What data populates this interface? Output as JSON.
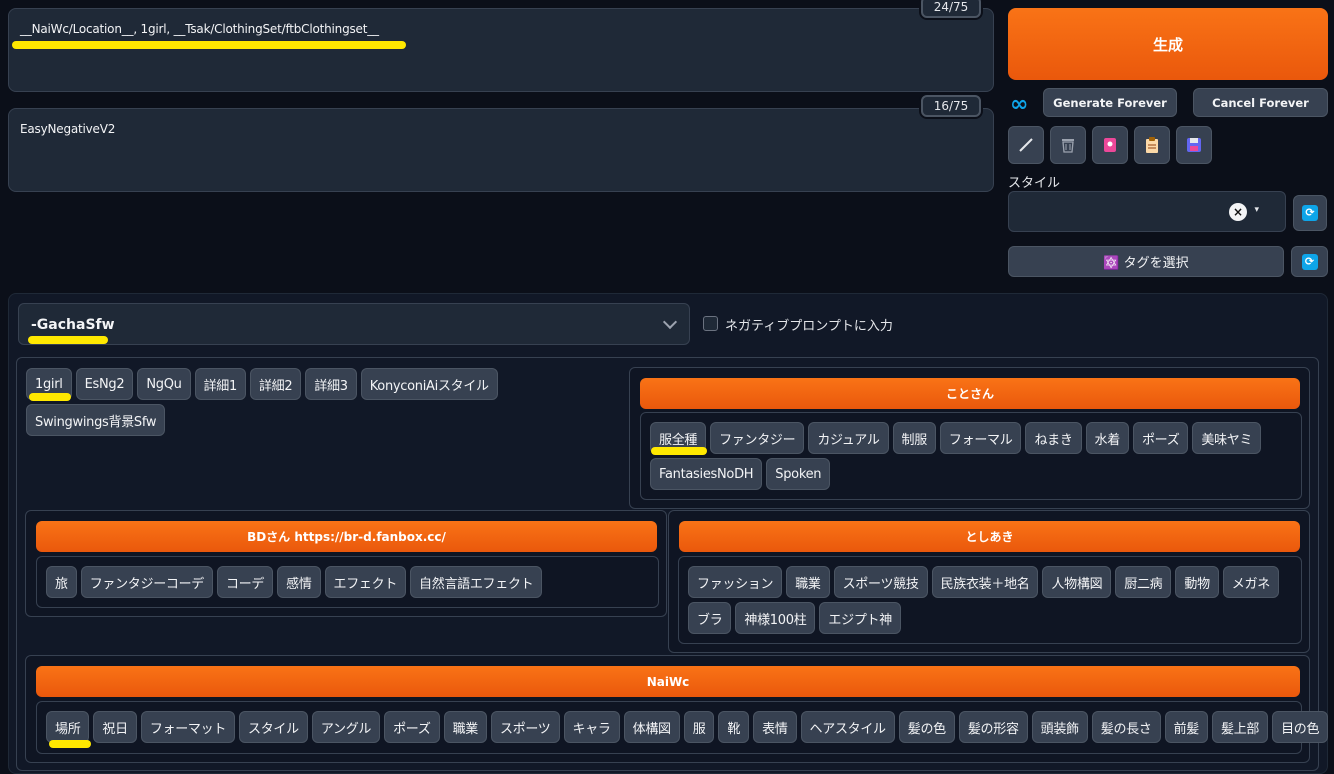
{
  "prompt": {
    "text": "__NaiWc/Location__, 1girl, __Tsak/ClothingSet/ftbClothingset__",
    "counter": "24/75"
  },
  "negative_prompt": {
    "text": "EasyNegativeV2",
    "counter": "16/75"
  },
  "actions": {
    "generate": "生成",
    "generate_forever": "Generate Forever",
    "cancel_forever": "Cancel Forever",
    "infinity": "∞"
  },
  "tools": [
    "pencil-icon",
    "trash-icon",
    "pink-card-icon",
    "clipboard-icon",
    "save-icon"
  ],
  "style": {
    "label": "スタイル",
    "clear": "×",
    "caret": "▾"
  },
  "tag_select": {
    "label": "🔯 タグを選択",
    "refresh": "⟳"
  },
  "wildcard": {
    "selected": "-GachaSfw",
    "negative_checkbox_label": "ネガティブプロンプトに入力"
  },
  "top_tags": [
    "1girl",
    "EsNg2",
    "NgQu",
    "詳細1",
    "詳細2",
    "詳細3",
    "KonyconiAiスタイル",
    "Swingwings背景Sfw"
  ],
  "groups": {
    "kotosan": {
      "title": "ことさん",
      "tags": [
        "服全種",
        "ファンタジー",
        "カジュアル",
        "制服",
        "フォーマル",
        "ねまき",
        "水着",
        "ポーズ",
        "美味ヤミ",
        "FantasiesNoDH",
        "Spoken"
      ]
    },
    "bd": {
      "title": "BDさん https://br-d.fanbox.cc/",
      "tags": [
        "旅",
        "ファンタジーコーデ",
        "コーデ",
        "感情",
        "エフェクト",
        "自然言語エフェクト"
      ]
    },
    "toshiaki": {
      "title": "としあき",
      "tags": [
        "ファッション",
        "職業",
        "スポーツ競技",
        "民族衣装＋地名",
        "人物構図",
        "厨二病",
        "動物",
        "メガネ",
        "ブラ",
        "神様100柱",
        "エジプト神"
      ]
    },
    "naiwc": {
      "title": "NaiWc",
      "tags": [
        "場所",
        "祝日",
        "フォーマット",
        "スタイル",
        "アングル",
        "ポーズ",
        "職業",
        "スポーツ",
        "キャラ",
        "体構図",
        "服",
        "靴",
        "表情",
        "ヘアスタイル",
        "髪の色",
        "髪の形容",
        "頭装飾",
        "髪の長さ",
        "前髪",
        "髪上部",
        "目の色"
      ]
    }
  },
  "colors": {
    "accent": "#f97316",
    "highlight": "#ffe800",
    "link": "#0ea5e9"
  }
}
